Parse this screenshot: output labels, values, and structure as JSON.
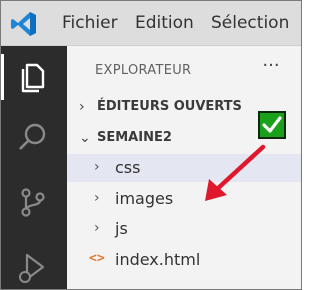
{
  "menu": {
    "items": [
      "Fichier",
      "Edition",
      "Sélection"
    ]
  },
  "sidebar": {
    "title": "EXPLORATEUR",
    "more_label": "···",
    "sections": {
      "open_editors": "ÉDITEURS OUVERTS",
      "workspace": "SEMAINE2"
    },
    "tree": [
      {
        "label": "css",
        "kind": "folder",
        "selected": true
      },
      {
        "label": "images",
        "kind": "folder",
        "selected": false
      },
      {
        "label": "js",
        "kind": "folder",
        "selected": false
      },
      {
        "label": "index.html",
        "kind": "file",
        "selected": false
      }
    ],
    "chevron_right": "›",
    "chevron_down": "⌄",
    "file_icon_glyph": "<>"
  },
  "annotations": {
    "check_color": "#1aa01a",
    "arrow_color": "#e0182d"
  },
  "colors": {
    "activitybar": "#2c2c2c",
    "titlebar": "#dddddd",
    "sidebar": "#f3f3f3",
    "selection": "#e4e6f1"
  }
}
